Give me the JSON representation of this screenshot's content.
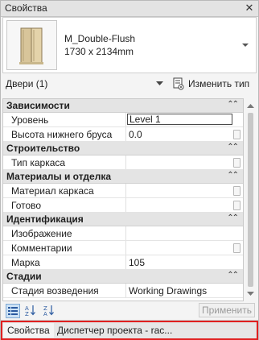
{
  "window": {
    "title": "Свойства",
    "close_icon": "close-icon"
  },
  "type_selector": {
    "family_name": "M_Double-Flush",
    "size": "1730 x 2134mm",
    "thumbnail_icon": "double-door-icon"
  },
  "filter": {
    "label": "Двери (1)",
    "edit_type_label": "Изменить тип"
  },
  "groups": [
    {
      "label": "Зависимости",
      "rows": [
        {
          "name": "Уровень",
          "value": "Level 1",
          "editing": true
        },
        {
          "name": "Высота нижнего бруса",
          "value": "0.0"
        }
      ]
    },
    {
      "label": "Строительство",
      "rows": [
        {
          "name": "Тип каркаса",
          "value": ""
        }
      ]
    },
    {
      "label": "Материалы и отделка",
      "rows": [
        {
          "name": "Материал каркаса",
          "value": ""
        },
        {
          "name": "Готово",
          "value": ""
        }
      ]
    },
    {
      "label": "Идентификация",
      "rows": [
        {
          "name": "Изображение",
          "value": ""
        },
        {
          "name": "Комментарии",
          "value": ""
        },
        {
          "name": "Марка",
          "value": "105"
        }
      ]
    },
    {
      "label": "Стадии",
      "rows": [
        {
          "name": "Стадия возведения",
          "value": "Working Drawings"
        }
      ]
    }
  ],
  "toolbar": {
    "apply_label": "Применить"
  },
  "tabs": [
    {
      "label": "Свойства"
    },
    {
      "label": "Диспетчер проекта - rac..."
    }
  ],
  "colors": {
    "highlight_border": "#e02020",
    "active_tool": "#cde2f5"
  }
}
